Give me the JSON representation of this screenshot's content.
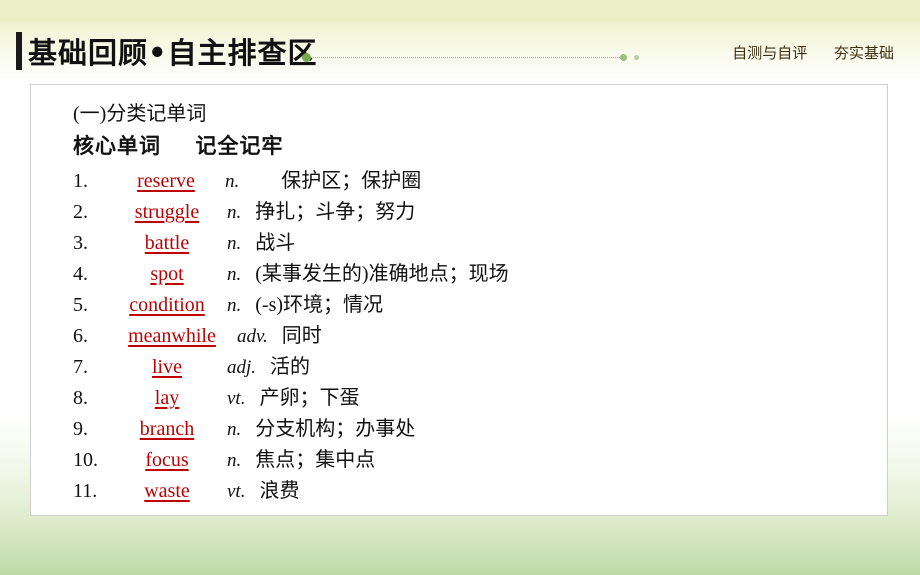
{
  "header": {
    "title": "基础回顾•自主排查区",
    "right_items": [
      "自测与自评",
      "夯实基础"
    ]
  },
  "content": {
    "section_label": "(一)分类记单词",
    "sub_heading_left": "核心单词",
    "sub_heading_right": "记全记牢",
    "vocab": [
      {
        "num": "1.",
        "word": "reserve",
        "pos": "n.",
        "def": "保护区；保护圈",
        "word_w": 110,
        "def_indent": 42
      },
      {
        "num": "2.",
        "word": "struggle",
        "pos": "n.",
        "def": "挣扎；斗争；努力",
        "word_w": 112,
        "def_indent": 14
      },
      {
        "num": "3.",
        "word": "battle",
        "pos": "n.",
        "def": "战斗",
        "word_w": 112,
        "def_indent": 14
      },
      {
        "num": "4.",
        "word": "spot",
        "pos": "n.",
        "def": "(某事发生的)准确地点；现场",
        "word_w": 112,
        "def_indent": 14
      },
      {
        "num": "5.",
        "word": "condition",
        "pos": "n.",
        "def": "(-s)环境；情况",
        "word_w": 112,
        "def_indent": 14
      },
      {
        "num": "6.",
        "word": "meanwhile",
        "pos": "adv.",
        "def": "同时",
        "word_w": 122,
        "def_indent": 14
      },
      {
        "num": "7.",
        "word": "live",
        "pos": "adj.",
        "def": "活的",
        "word_w": 112,
        "def_indent": 14
      },
      {
        "num": "8.",
        "word": "lay",
        "pos": "vt.",
        "def": "产卵；下蛋",
        "word_w": 112,
        "def_indent": 14
      },
      {
        "num": "9.",
        "word": "branch",
        "pos": "n.",
        "def": "分支机构；办事处",
        "word_w": 112,
        "def_indent": 14
      },
      {
        "num": "10.",
        "word": "focus",
        "pos": "n.",
        "def": "焦点；集中点",
        "word_w": 112,
        "def_indent": 14
      },
      {
        "num": "11.",
        "word": "waste",
        "pos": "vt.",
        "def": "浪费",
        "word_w": 112,
        "def_indent": 14
      }
    ]
  },
  "colors": {
    "word_red": "#c00000",
    "accent_green": "#7aa84f",
    "band": "#eceec6"
  }
}
